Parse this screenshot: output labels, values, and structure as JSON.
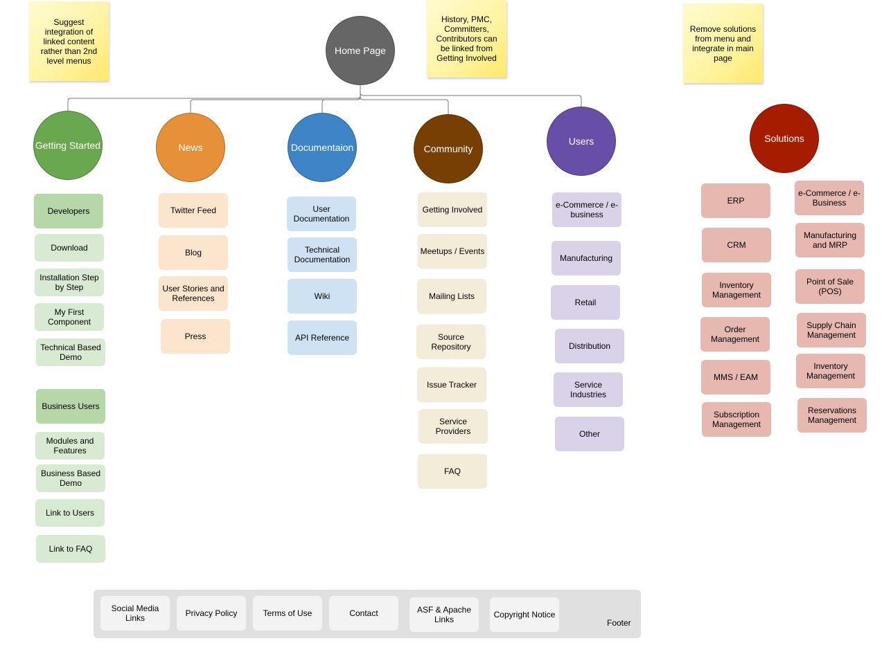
{
  "home": "Home Page",
  "notes": [
    "Suggest integration of linked content rather than 2nd level menus",
    "History, PMC, Committers, Contributors can be linked from Getting Involved",
    "Remove solutions from menu and integrate in main page"
  ],
  "sections": [
    {
      "title": "Getting Started",
      "color": "#6aa84f",
      "items": [
        "Developers",
        "Download",
        "Installation Step by Step",
        "My First Component",
        "Technical Based Demo",
        "Business Users",
        "Modules and Features",
        "Business Based Demo",
        "Link to Users",
        "Link to FAQ"
      ]
    },
    {
      "title": "News",
      "color": "#e69138",
      "items": [
        "Twitter Feed",
        "Blog",
        "User Stories and References",
        "Press"
      ]
    },
    {
      "title": "Documentaion",
      "color": "#3d85c6",
      "items": [
        "User Documentation",
        "Technical Documentation",
        "Wiki",
        "API Reference"
      ]
    },
    {
      "title": "Community",
      "color": "#783f04",
      "items": [
        "Getting Involved",
        "Meetups / Events",
        "Mailing Lists",
        "Source Repository",
        "Issue Tracker",
        "Service Providers",
        "FAQ"
      ]
    },
    {
      "title": "Users",
      "color": "#674ea7",
      "items": [
        "e-Commerce / e-business",
        "Manufacturing",
        "Retail",
        "Distribution",
        "Service Industries",
        "Other"
      ]
    },
    {
      "title": "Solutions",
      "color": "#a61c00",
      "items": [
        "ERP",
        "CRM",
        "Inventory Management",
        "Order Management",
        "MMS / EAM",
        "Subscription Management",
        "e-Commerce / e-Business",
        "Manufacturing and MRP",
        "Point of Sale (POS)",
        "Supply Chain Management",
        "Inventory Management",
        "Reservations Management"
      ]
    }
  ],
  "footer": {
    "label": "Footer",
    "items": [
      "Social Media Links",
      "Privacy Policy",
      "Terms of Use",
      "Contact",
      "ASF & Apache Links",
      "Copyright Notice"
    ]
  },
  "colors": {
    "home": "#666666",
    "box_fills": [
      "#d9ead3",
      "#fce5cd",
      "#cfe2f3",
      "#f3ecd8",
      "#d9d2e9",
      "#e6b8af"
    ],
    "box_fill_emphasis": "#b6d7a8",
    "footer": "#e0e0e0"
  }
}
